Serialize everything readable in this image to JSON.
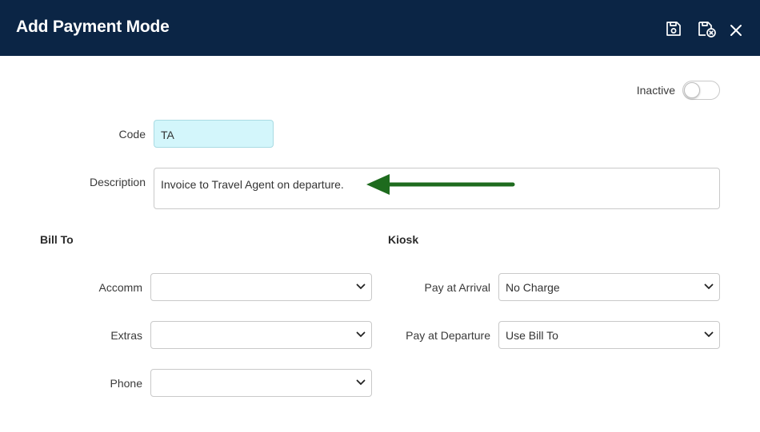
{
  "header": {
    "title": "Add Payment Mode",
    "background_color": "#0b2545",
    "actions": [
      {
        "name": "save-icon"
      },
      {
        "name": "save-and-close-icon"
      },
      {
        "name": "close-icon"
      }
    ]
  },
  "form": {
    "inactive": {
      "label": "Inactive",
      "checked": false
    },
    "code": {
      "label": "Code",
      "value": "TA",
      "background_color": "#d3f6fb"
    },
    "description": {
      "label": "Description",
      "value": "Invoice to Travel Agent on departure."
    }
  },
  "bill_to": {
    "title": "Bill To",
    "fields": [
      {
        "label": "Accomm",
        "value": ""
      },
      {
        "label": "Extras",
        "value": ""
      },
      {
        "label": "Phone",
        "value": ""
      }
    ]
  },
  "kiosk": {
    "title": "Kiosk",
    "fields": [
      {
        "label": "Pay at Arrival",
        "value": "No Charge"
      },
      {
        "label": "Pay at Departure",
        "value": "Use Bill To"
      }
    ]
  },
  "annotation": {
    "icon": "green-arrow-icon",
    "color": "#1e6b1e"
  }
}
